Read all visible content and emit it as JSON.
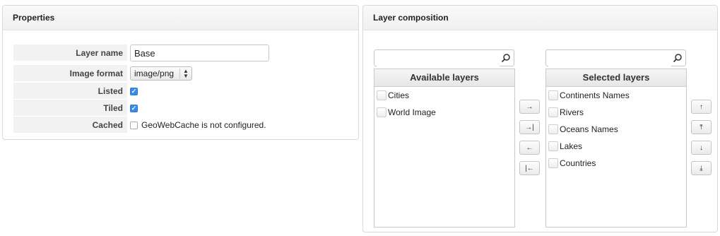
{
  "properties": {
    "title": "Properties",
    "layer_name_label": "Layer name",
    "layer_name_value": "Base",
    "image_format_label": "Image format",
    "image_format_value": "image/png",
    "listed_label": "Listed",
    "listed_checked": true,
    "tiled_label": "Tiled",
    "tiled_checked": true,
    "cached_label": "Cached",
    "cached_checked": false,
    "cached_text": "GeoWebCache is not configured."
  },
  "composition": {
    "title": "Layer composition",
    "available": {
      "header": "Available layers",
      "search_value": "",
      "items": [
        "Cities",
        "World Image"
      ]
    },
    "selected": {
      "header": "Selected layers",
      "search_value": "",
      "items": [
        "Continents Names",
        "Rivers",
        "Oceans Names",
        "Lakes",
        "Countries"
      ]
    },
    "transfer_buttons": {
      "add": "→",
      "add_all": "→|",
      "remove": "←",
      "remove_all": "|←"
    },
    "order_buttons": {
      "move_up": "↑",
      "move_top": "⤒",
      "move_down": "↓",
      "move_bottom": "⤓"
    }
  },
  "colors": {
    "checkbox_checked": "#3b8bea",
    "panel_border": "#d9d9d9",
    "label_bg": "#f2f2f2"
  }
}
